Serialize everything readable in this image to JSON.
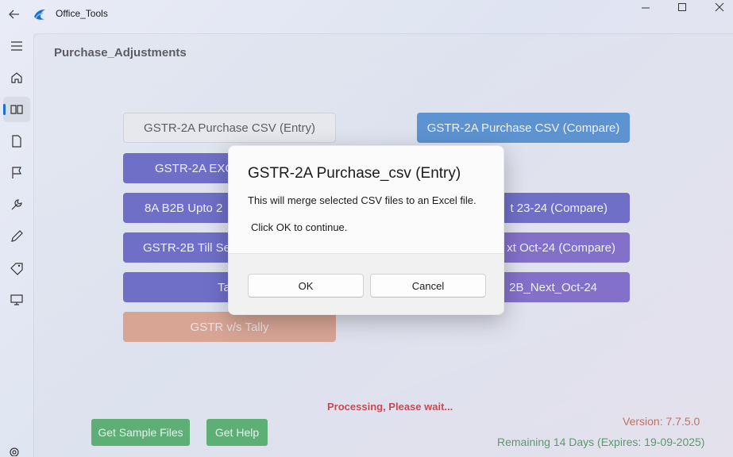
{
  "titlebar": {
    "title": "Office_Tools",
    "back_icon": "back-arrow-icon",
    "logo_icon": "office-tools-logo-icon"
  },
  "nav": {
    "items": [
      {
        "name": "menu",
        "icon": "hamburger-icon"
      },
      {
        "name": "home",
        "icon": "home-icon"
      },
      {
        "name": "books",
        "icon": "book-icon"
      },
      {
        "name": "document",
        "icon": "document-icon"
      },
      {
        "name": "flag",
        "icon": "flag-icon"
      },
      {
        "name": "tools",
        "icon": "wrench-icon"
      },
      {
        "name": "edit",
        "icon": "pencil-icon"
      },
      {
        "name": "tag",
        "icon": "tag-icon"
      },
      {
        "name": "desktop",
        "icon": "monitor-icon"
      },
      {
        "name": "settings",
        "icon": "gear-icon"
      }
    ]
  },
  "page": {
    "title": "Purchase_Adjustments",
    "tiles": {
      "gstr2a_entry": "GSTR-2A Purchase CSV (Entry)",
      "gstr2a_compare": "GSTR-2A Purchase CSV (Compare)",
      "gstr2a_excel": "GSTR-2A EXC",
      "b2b_upto": "8A B2B Upto 2",
      "b2b_upto_compare": "t 23-24 (Compare)",
      "gstr2b_till": "GSTR-2B Till Se",
      "gstr2b_next_compare": "xt Oct-24 (Compare)",
      "tally": "Tally",
      "gstr2b_next": "2B_Next_Oct-24",
      "gstr_vs_tally": "GSTR v/s Tally"
    },
    "processing": "Processing, Please wait...",
    "get_sample_files": "Get Sample Files",
    "get_help": "Get Help",
    "version": "Version: 7.7.5.0",
    "remaining": "Remaining 14 Days (Expires: 19-09-2025)"
  },
  "dialog": {
    "title": "GSTR-2A Purchase_csv (Entry)",
    "message": "This will merge selected CSV files to an Excel file.",
    "instruction": "Click OK to continue.",
    "ok": "OK",
    "cancel": "Cancel"
  },
  "colors": {
    "accent_blue": "#1f6fc7",
    "indigo": "#3b38b8",
    "purple": "#5a3ab8",
    "orange": "#dc8a6a",
    "green": "#1f9a3a",
    "processing_red": "#c00000"
  }
}
